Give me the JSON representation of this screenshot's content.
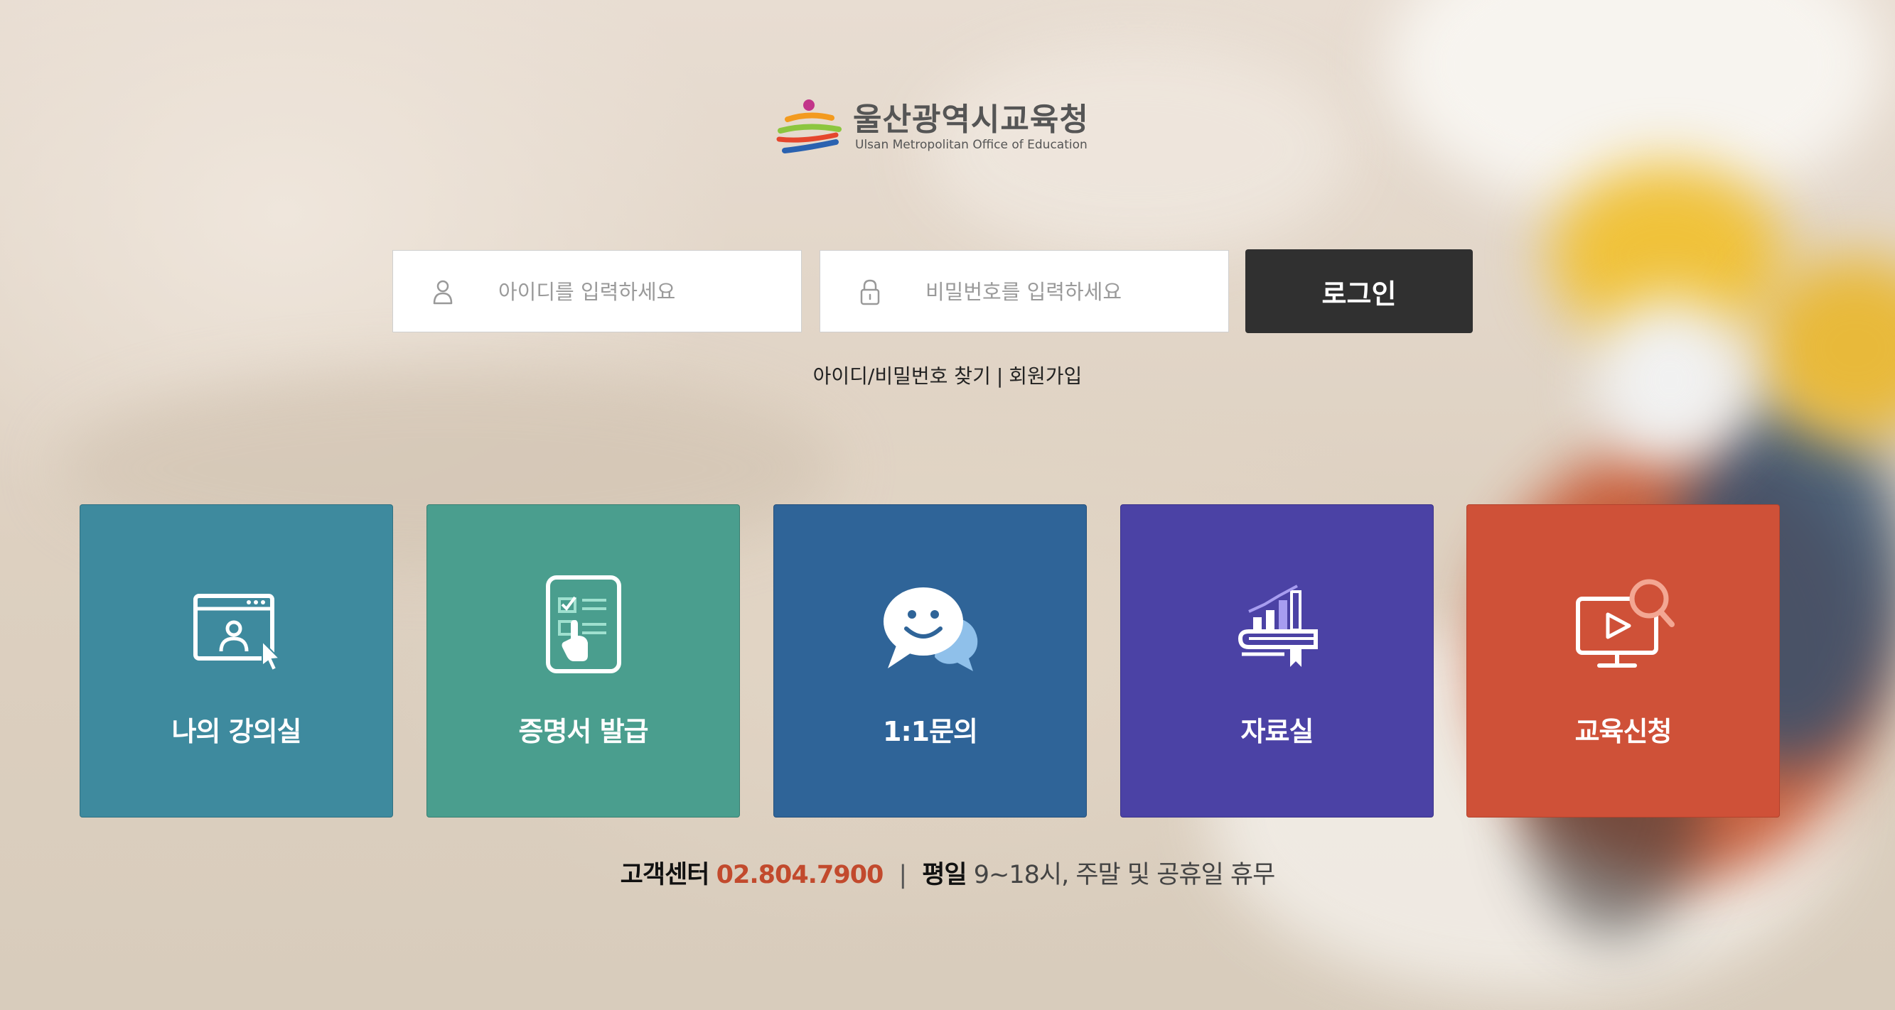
{
  "org": {
    "name_ko": "울산광역시교육청",
    "name_en": "Ulsan Metropolitan Office of Education"
  },
  "login": {
    "id_placeholder": "아이디를 입력하세요",
    "pw_placeholder": "비밀번호를 입력하세요",
    "button_label": "로그인",
    "find_link": "아이디/비밀번호 찾기",
    "separator": "|",
    "signup_link": "회원가입"
  },
  "menu": [
    {
      "label": "나의 강의실",
      "icon": "classroom-icon",
      "color": "#3e8a9e"
    },
    {
      "label": "증명서 발급",
      "icon": "certificate-icon",
      "color": "#4a9e8e"
    },
    {
      "label": "1:1문의",
      "icon": "chat-icon",
      "color": "#2f6498"
    },
    {
      "label": "자료실",
      "icon": "library-icon",
      "color": "#4b42a5"
    },
    {
      "label": "교육신청",
      "icon": "video-search-icon",
      "color": "#cf5138"
    }
  ],
  "footer": {
    "center_label": "고객센터",
    "phone": "02.804.7900",
    "separator": "|",
    "hours_label": "평일",
    "hours_text": "9~18시, 주말 및 공휴일 휴무"
  }
}
